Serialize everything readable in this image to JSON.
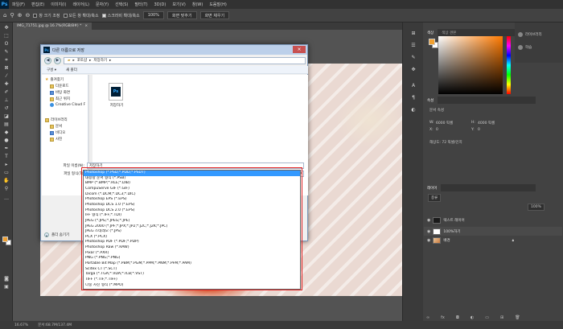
{
  "app": {
    "logo": "Ps",
    "menu": [
      "파일(F)",
      "편집(E)",
      "이미지(I)",
      "레이어(L)",
      "문자(Y)",
      "선택(S)",
      "필터(T)",
      "3D(D)",
      "보기(V)",
      "창(W)",
      "도움말(H)"
    ]
  },
  "options": {
    "check1": "창 크기 조정",
    "check2": "모든 창 확대/축소",
    "check3": "스크러비 확대/축소",
    "zoom": "100%",
    "fit_screen": "화면 맞추기",
    "fill_screen": "화면 채우기"
  },
  "document": {
    "tab": "IMG_71751.jpg @ 16.7%(RGB/8#) *"
  },
  "status": {
    "zoom": "16.67%",
    "doc_size": "문서:68.7M/137.4M"
  },
  "panels": {
    "color_tabs": [
      "색상",
      "색상 견본"
    ],
    "side_items": [
      "라이브러리",
      "학습"
    ],
    "properties_tab": "속성",
    "properties_title": "문서 속성",
    "width_label": "W:",
    "width_value": "6000 픽셀",
    "height_label": "H:",
    "height_value": "4000 픽셀",
    "x_label": "X:",
    "x_value": "0",
    "y_label": "Y:",
    "y_value": "0",
    "resolution": "해상도: 72 픽셀/인치",
    "layers_tab": "레이어",
    "layer_filter": "종류",
    "layer_opacity": "100%",
    "layers": [
      {
        "name": "텍스트 레이어"
      },
      {
        "name": "100%하기"
      },
      {
        "name": "배경"
      }
    ]
  },
  "dialog": {
    "title": "다른 이름으로 저장",
    "address": [
      "포토샵",
      "저장하기"
    ],
    "organize": "구성 ▾",
    "new_folder": "새 폴더",
    "tree": [
      {
        "label": "즐겨찾기",
        "icon": "star-icon"
      },
      {
        "label": "다운로드",
        "icon": "folder-icon"
      },
      {
        "label": "바탕 화면",
        "icon": "folder-icon"
      },
      {
        "label": "최근 위치",
        "icon": "folder-icon"
      },
      {
        "label": "Creative Cloud F",
        "icon": "cloud-icon"
      },
      {
        "label": "라이브러리",
        "icon": "folder-icon"
      },
      {
        "label": "문서",
        "icon": "folder-icon"
      },
      {
        "label": "비디오",
        "icon": "folder-icon"
      },
      {
        "label": "사진",
        "icon": "folder-icon"
      }
    ],
    "file": {
      "name": "저장하기",
      "icon_text": "Ps"
    },
    "filename_label": "파일 이름(N):",
    "filename_value": "저장하기",
    "format_label": "파일 형식(T):",
    "format_value": "Photoshop (*.PSD;*.PDD;*.PSDT)",
    "hide_folders": "폴더 숨기기",
    "formats": [
      "Photoshop (*.PSD;*.PDD;*.PSDT)",
      "대용량 문서 형식 (*.PSB)",
      "BMP (*.BMP;*.RLE;*.DIB)",
      "CompuServe GIF (*.GIF)",
      "Dicom (*.DCM;*.DC3;*.DIC)",
      "Photoshop EPS (*.EPS)",
      "Photoshop DCS 1.0 (*.EPS)",
      "Photoshop DCS 2.0 (*.EPS)",
      "IFF 형식 (*.IFF;*.TDI)",
      "JPEG (*.JPG;*.JPEG;*.JPE)",
      "JPEG 2000 (*.JPF;*.JPX;*.JP2;*.J2C;*.J2K;*.JPC)",
      "JPEG 스테레오 (*.JPS)",
      "PCX (*.PCX)",
      "Photoshop PDF (*.PDF;*.PDP)",
      "Photoshop Raw (*.RAW)",
      "Pixar (*.PXR)",
      "PNG (*.PNG;*.PNG)",
      "Portable Bit Map (*.PBM;*.PGM;*.PPM;*.PNM;*.PFM;*.PAM)",
      "Scitex CT (*.SCT)",
      "Targa (*.TGA;*.VDA;*.ICB;*.VST)",
      "TIFF (*.TIF;*.TIFF)",
      "다중 사진 형식 (*.MPO)"
    ],
    "selected_format_index": 0
  }
}
